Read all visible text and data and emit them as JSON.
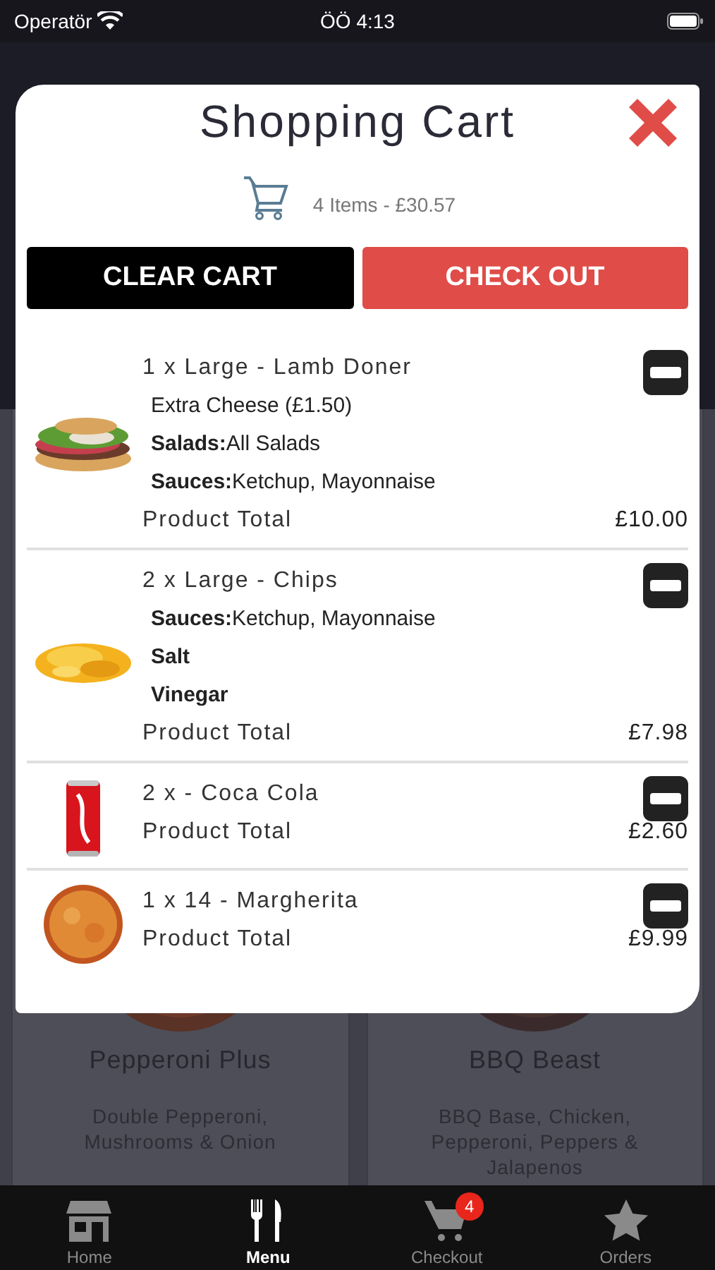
{
  "status_bar": {
    "carrier": "Operatör",
    "time": "ÖÖ 4:13"
  },
  "menu_cards": [
    {
      "name": "Pepperoni Plus",
      "description": "Double Pepperoni, Mushrooms & Onion",
      "image": {
        "kind": "picture"
      }
    },
    {
      "name": "BBQ Beast",
      "description": "BBQ Base, Chicken, Pepperoni, Peppers & Jalapenos",
      "image": {
        "kind": "picture"
      }
    }
  ],
  "cart_dialog": {
    "title": "Shopping Cart",
    "summary": "4 Items - £30.57",
    "buttons": [
      {
        "label": "CLEAR CART",
        "kind": "secondary"
      },
      {
        "label": "CHECK OUT",
        "kind": "primary"
      }
    ],
    "items": [
      {
        "image": {
          "kind": "picture"
        },
        "title": "1 x Large - Lamb Doner",
        "details": [
          {
            "text": "Extra Cheese (£1.50)",
            "bold": false
          },
          {
            "text": "**Salads:**All Salads",
            "bold": false
          },
          {
            "text": "**Sauces:**Ketchup, Mayonnaise",
            "bold": false
          }
        ],
        "total_label": "Product Total",
        "total": "£10.00"
      },
      {
        "image": {
          "kind": "picture"
        },
        "title": "2 x Large - Chips",
        "details": [
          {
            "text": "**Sauces:**Ketchup, Mayonnaise",
            "bold": false
          },
          {
            "text": "Salt",
            "bold": true
          },
          {
            "text": "Vinegar",
            "bold": true
          }
        ],
        "total_label": "Product Total",
        "total": "£7.98"
      },
      {
        "image": {
          "kind": "picture"
        },
        "title": "2 x - Coca Cola",
        "total_label": "Product Total",
        "total": "£2.60"
      },
      {
        "image": {
          "kind": "picture"
        },
        "title": "1 x 14 - Margherita",
        "total_label": "Product Total",
        "total": "£9.99"
      }
    ]
  },
  "tab_bar": [
    {
      "label": "Home",
      "selected": false
    },
    {
      "label": "Menu",
      "selected": true
    },
    {
      "label": "Checkout",
      "selected": false,
      "badge": "4"
    },
    {
      "label": "Orders",
      "selected": false
    }
  ]
}
